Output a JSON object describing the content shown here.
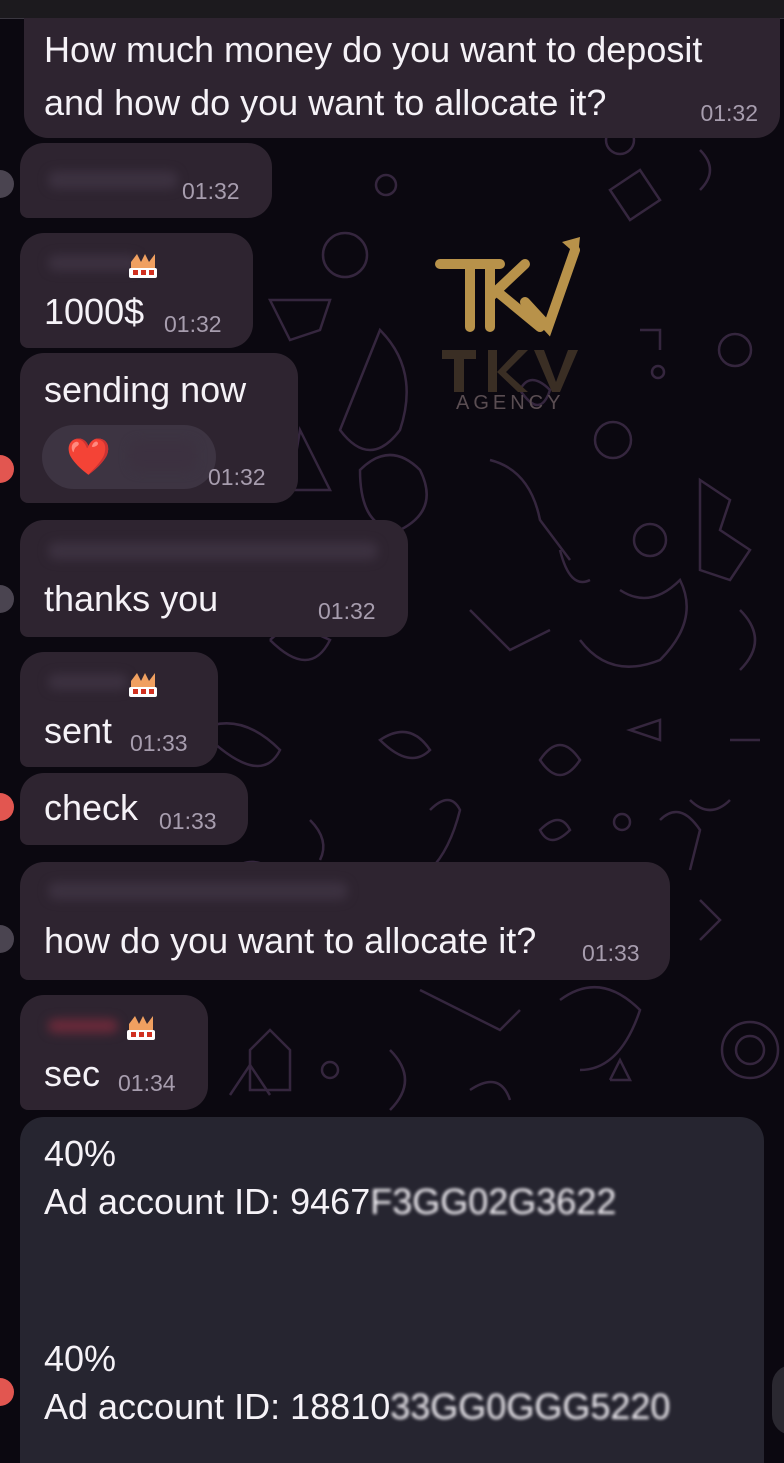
{
  "messages": [
    {
      "id": "m1",
      "text_lines": [
        "How much money do you want to deposit",
        "and how do you want to allocate it?"
      ],
      "time": "01:32"
    },
    {
      "id": "m2",
      "text": "",
      "time": "01:32"
    },
    {
      "id": "m3",
      "text": "1000$",
      "time": "01:32"
    },
    {
      "id": "m4",
      "text": "sending now",
      "time": "01:32",
      "reaction": "❤️"
    },
    {
      "id": "m5",
      "text": "thanks you",
      "time": "01:32"
    },
    {
      "id": "m6",
      "text": "sent",
      "time": "01:33"
    },
    {
      "id": "m7",
      "text": "check",
      "time": "01:33"
    },
    {
      "id": "m8",
      "text": "how do you want to allocate it?",
      "time": "01:33"
    },
    {
      "id": "m9",
      "text": "sec",
      "time": "01:34"
    },
    {
      "id": "m10",
      "lines": [
        "40%",
        "Ad account ID: 9467",
        "",
        "",
        "40%",
        "Ad account ID: 18810"
      ],
      "redacted_suffixes": [
        "F3GG02G3622",
        "33GG0GGG5220"
      ]
    }
  ],
  "watermark": {
    "brand": "TKV",
    "subtitle": "AGENCY",
    "color": "#b8924a"
  },
  "colors": {
    "bubble": "#2e2430",
    "bubble_large": "#262530",
    "background": "#0b0810",
    "time": "#a79dae",
    "text": "#f5f2f7",
    "avatar": "#e25650"
  }
}
